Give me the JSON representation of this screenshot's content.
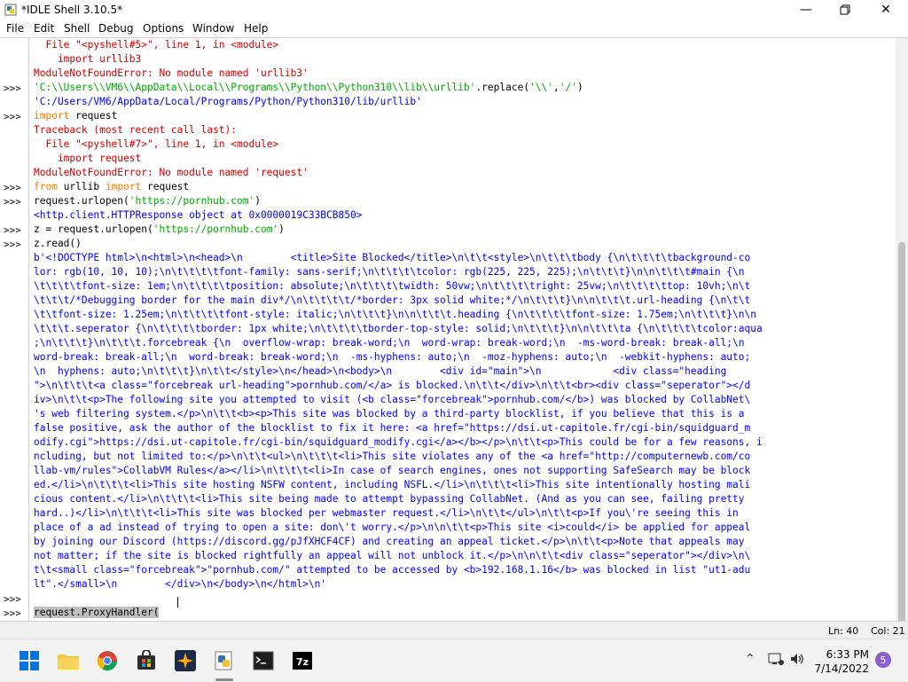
{
  "window": {
    "title": "*IDLE Shell 3.10.5*",
    "icons": {
      "app": "python-idle-icon",
      "minimize": "minimize-icon",
      "maximize": "maximize-icon",
      "close": "close-icon"
    }
  },
  "menu": [
    "File",
    "Edit",
    "Shell",
    "Debug",
    "Options",
    "Window",
    "Help"
  ],
  "prompts": {
    "p1": ">>>",
    "p2": ">>>",
    "p3": ">>>",
    "p4": ">>>",
    "p5": ">>>",
    "p6": ">>>",
    "p7": ">>>",
    "p8": ">>>",
    "p9": ">>>"
  },
  "lines": {
    "l1": "  File \"<pyshell#5>\", line 1, in <module>",
    "l2": "    import urllib3",
    "l3": "ModuleNotFoundError: No module named 'urllib3'",
    "l4a": "'C:\\\\Users\\\\VM6\\\\AppData\\\\Local\\\\Programs\\\\Python\\\\Python310\\\\lib\\\\urllib'",
    "l4b": ".replace(",
    "l4c": "'\\\\'",
    "l4d": ",",
    "l4e": "'/'",
    "l4f": ")",
    "l5": "'C:/Users/VM6/AppData/Local/Programs/Python/Python310/lib/urllib'",
    "l6a": "import",
    "l6b": " request",
    "l7": "Traceback (most recent call last):",
    "l8": "  File \"<pyshell#7>\", line 1, in <module>",
    "l9": "    import request",
    "l10": "ModuleNotFoundError: No module named 'request'",
    "l11a": "from",
    "l11b": " urllib ",
    "l11c": "import",
    "l11d": " request",
    "l12a": "request.urlopen(",
    "l12b": "'https://pornhub.com'",
    "l12c": ")",
    "l13": "<http.client.HTTPResponse object at 0x0000019C33BCB850>",
    "l14a": "z = request.urlopen(",
    "l14b": "'https://pornhub.com'",
    "l14c": ")",
    "l15": "z.read()",
    "out": [
      "b'<!DOCTYPE html>\\n<html>\\n<head>\\n        <title>Site Blocked</title>\\n\\t\\t<style>\\n\\t\\t\\tbody {\\n\\t\\t\\t\\tbackground-co",
      "lor: rgb(10, 10, 10);\\n\\t\\t\\t\\tfont-family: sans-serif;\\n\\t\\t\\t\\tcolor: rgb(225, 225, 225);\\n\\t\\t\\t}\\n\\n\\t\\t\\t#main {\\n",
      "\\t\\t\\t\\tfont-size: 1em;\\n\\t\\t\\t\\tposition: absolute;\\n\\t\\t\\t\\twidth: 50vw;\\n\\t\\t\\t\\tright: 25vw;\\n\\t\\t\\t\\ttop: 10vh;\\n\\t",
      "\\t\\t\\t/*Debugging border for the main div*/\\n\\t\\t\\t\\t/*border: 3px solid white;*/\\n\\t\\t\\t}\\n\\n\\t\\t\\t.url-heading {\\n\\t\\t",
      "\\t\\tfont-size: 1.25em;\\n\\t\\t\\t\\tfont-style: italic;\\n\\t\\t\\t}\\n\\n\\t\\t\\t.heading {\\n\\t\\t\\t\\tfont-size: 1.75em;\\n\\t\\t\\t}\\n\\n",
      "\\t\\t\\t.seperator {\\n\\t\\t\\t\\tborder: 1px white;\\n\\t\\t\\t\\tborder-top-style: solid;\\n\\t\\t\\t}\\n\\n\\t\\t\\ta {\\n\\t\\t\\t\\tcolor:aqua",
      ";\\n\\t\\t\\t}\\n\\t\\t\\t.forcebreak {\\n  overflow-wrap: break-word;\\n  word-wrap: break-word;\\n  -ms-word-break: break-all;\\n",
      "word-break: break-all;\\n  word-break: break-word;\\n  -ms-hyphens: auto;\\n  -moz-hyphens: auto;\\n  -webkit-hyphens: auto;",
      "\\n  hyphens: auto;\\n\\t\\t\\t}\\n\\t\\t</style>\\n</head>\\n<body>\\n        <div id=\"main\">\\n            <div class=\"heading",
      "\">\\n\\t\\t\\t<a class=\"forcebreak url-heading\">pornhub.com/</a> is blocked.\\n\\t\\t</div>\\n\\t\\t<br><div class=\"seperator\"></d",
      "iv>\\n\\t\\t<p>The following site you attempted to visit (<b class=\"forcebreak\">pornhub.com/</b>) was blocked by CollabNet\\",
      "'s web filtering system.</p>\\n\\t\\t<b><p>This site was blocked by a third-party blocklist, if you believe that this is a",
      "false positive, ask the author of the blocklist to fix it here: <a href=\"https://dsi.ut-capitole.fr/cgi-bin/squidguard_m",
      "odify.cgi\">https://dsi.ut-capitole.fr/cgi-bin/squidguard_modify.cgi</a></b></p>\\n\\t\\t<p>This could be for a few reasons, i",
      "ncluding, but not limited to:</p>\\n\\t\\t<ul>\\n\\t\\t\\t<li>This site violates any of the <a href=\"http://computernewb.com/co",
      "llab-vm/rules\">CollabVM Rules</a></li>\\n\\t\\t\\t<li>In case of search engines, ones not supporting SafeSearch may be block",
      "ed.</li>\\n\\t\\t\\t<li>This site hosting NSFW content, including NSFL.</li>\\n\\t\\t\\t<li>This site intentionally hosting mali",
      "cious content.</li>\\n\\t\\t\\t<li>This site being made to attempt bypassing CollabNet. (And as you can see, failing pretty",
      "hard..)</li>\\n\\t\\t\\t<li>This site was blocked per webmaster request.</li>\\n\\t\\t</ul>\\n\\t\\t<p>If you\\'re seeing this in",
      "place of a ad instead of trying to open a site: don\\'t worry.</p>\\n\\n\\t\\t<p>This site <i>could</i> be applied for appeal",
      "by joining our Discord (https://discord.gg/pJfXHCF4CF) and creating an appeal ticket.</p>\\n\\t\\t<p>Note that appeals may",
      "not matter; if the site is blocked rightfully an appeal will not unblock it.</p>\\n\\n\\t\\t<div class=\"seperator\"></div>\\n\\",
      "t\\t<small class=\"forcebreak\">\"pornhub.com/\" attempted to be accessed by <b>192.168.1.16</b> was blocked in list \"ut1-adu",
      "lt\".</small>\\n        </div>\\n</body>\\n</html>\\n'"
    ],
    "last": "request.ProxyHandler("
  },
  "status": {
    "ln": "Ln: 40",
    "col": "Col: 21"
  },
  "taskbar": {
    "icons": [
      "windows-start-icon",
      "file-explorer-icon",
      "chrome-icon",
      "store-icon",
      "app-star-icon",
      "python-idle-icon",
      "terminal-icon",
      "7zip-icon"
    ],
    "tray_icons": [
      "chevron-up-icon",
      "network-icon",
      "volume-icon"
    ],
    "time": "6:33 PM",
    "date": "7/14/2022",
    "badge": "5"
  },
  "colors": {
    "error": "#cc0000",
    "keyword": "#ff7700",
    "string": "#00aa00",
    "output": "#0000ff"
  }
}
